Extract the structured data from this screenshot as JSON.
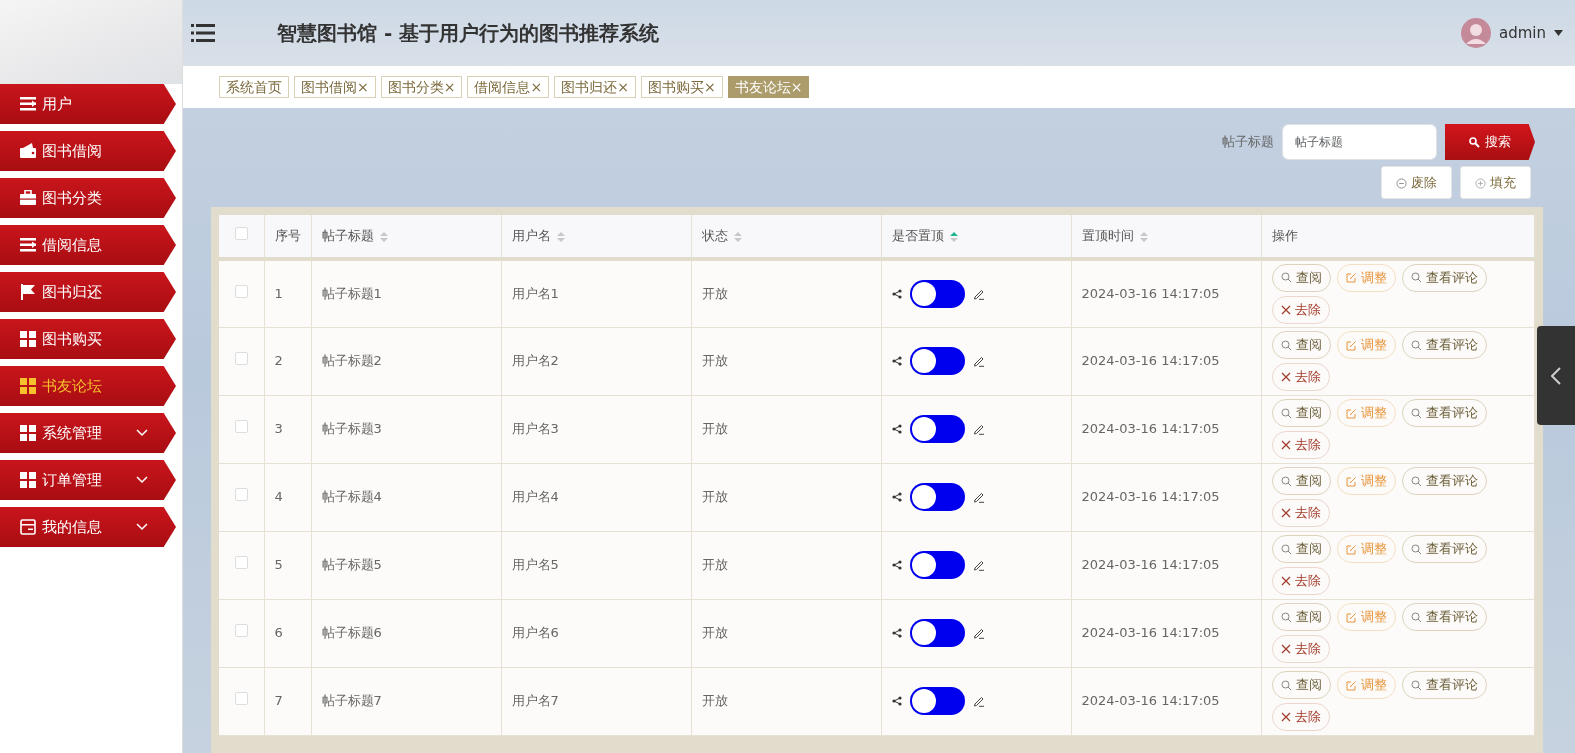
{
  "sidebar": {
    "items": [
      {
        "kind": "list",
        "label": "用户",
        "selected": false
      },
      {
        "kind": "wallet",
        "label": "图书借阅",
        "selected": false
      },
      {
        "kind": "briefcase",
        "label": "图书分类",
        "selected": false
      },
      {
        "kind": "list",
        "label": "借阅信息",
        "selected": false
      },
      {
        "kind": "flag",
        "label": "图书归还",
        "selected": false
      },
      {
        "kind": "grid",
        "label": "图书购买",
        "selected": false
      },
      {
        "kind": "grid",
        "label": "书友论坛",
        "selected": true
      },
      {
        "kind": "grid",
        "label": "系统管理",
        "selected": false,
        "expanded": false
      },
      {
        "kind": "grid",
        "label": "订单管理",
        "selected": false,
        "expanded": false
      },
      {
        "kind": "card",
        "label": "我的信息",
        "selected": false,
        "expanded": false
      }
    ]
  },
  "header": {
    "title": "智慧图书馆 - 基于用户行为的图书推荐系统",
    "user": "admin"
  },
  "tabs": [
    {
      "label": "系统首页",
      "selected": false
    },
    {
      "label": "图书借阅",
      "close": "×",
      "selected": false
    },
    {
      "label": "图书分类",
      "close": "×",
      "selected": false
    },
    {
      "label": "借阅信息",
      "close": "×",
      "selected": false
    },
    {
      "label": "图书归还",
      "close": "×",
      "selected": false
    },
    {
      "label": "图书购买",
      "close": "×",
      "selected": false
    },
    {
      "label": "书友论坛",
      "close": "×",
      "selected": true
    }
  ],
  "search": {
    "label": "帖子标题",
    "placeholder": "帖子标题",
    "button": "搜索"
  },
  "toolbar": [
    {
      "kind": "remove",
      "label": "废除"
    },
    {
      "kind": "add",
      "label": "填充"
    }
  ],
  "table": {
    "select_all": {
      "checked": false
    },
    "columns": [
      {
        "label": "序号"
      },
      {
        "label": "帖子标题",
        "sortable": true,
        "sorted": false
      },
      {
        "label": "用户名",
        "sortable": true,
        "sorted": false
      },
      {
        "label": "状态",
        "sortable": true,
        "sorted": false
      },
      {
        "label": "是否置顶",
        "sortable": true,
        "sorted": true
      },
      {
        "label": "置顶时间",
        "sortable": true,
        "sorted": false
      },
      {
        "label": "操作"
      }
    ],
    "rows": [
      {
        "checked": false,
        "cells": [
          "1",
          "帖子标题1",
          "用户名1",
          "开放"
        ],
        "pinned": false,
        "time": "2024-03-16 14:17:05",
        "actions": [
          {
            "kind": "view",
            "label": "查阅"
          },
          {
            "kind": "edit",
            "label": "调整"
          },
          {
            "kind": "view",
            "label": "查看评论"
          },
          {
            "kind": "delete",
            "label": "去除"
          }
        ]
      },
      {
        "checked": false,
        "cells": [
          "2",
          "帖子标题2",
          "用户名2",
          "开放"
        ],
        "pinned": false,
        "time": "2024-03-16 14:17:05",
        "actions": [
          {
            "kind": "view",
            "label": "查阅"
          },
          {
            "kind": "edit",
            "label": "调整"
          },
          {
            "kind": "view",
            "label": "查看评论"
          },
          {
            "kind": "delete",
            "label": "去除"
          }
        ]
      },
      {
        "checked": false,
        "cells": [
          "3",
          "帖子标题3",
          "用户名3",
          "开放"
        ],
        "pinned": false,
        "time": "2024-03-16 14:17:05",
        "actions": [
          {
            "kind": "view",
            "label": "查阅"
          },
          {
            "kind": "edit",
            "label": "调整"
          },
          {
            "kind": "view",
            "label": "查看评论"
          },
          {
            "kind": "delete",
            "label": "去除"
          }
        ]
      },
      {
        "checked": false,
        "cells": [
          "4",
          "帖子标题4",
          "用户名4",
          "开放"
        ],
        "pinned": false,
        "time": "2024-03-16 14:17:05",
        "actions": [
          {
            "kind": "view",
            "label": "查阅"
          },
          {
            "kind": "edit",
            "label": "调整"
          },
          {
            "kind": "view",
            "label": "查看评论"
          },
          {
            "kind": "delete",
            "label": "去除"
          }
        ]
      },
      {
        "checked": false,
        "cells": [
          "5",
          "帖子标题5",
          "用户名5",
          "开放"
        ],
        "pinned": false,
        "time": "2024-03-16 14:17:05",
        "actions": [
          {
            "kind": "view",
            "label": "查阅"
          },
          {
            "kind": "edit",
            "label": "调整"
          },
          {
            "kind": "view",
            "label": "查看评论"
          },
          {
            "kind": "delete",
            "label": "去除"
          }
        ]
      },
      {
        "checked": false,
        "cells": [
          "6",
          "帖子标题6",
          "用户名6",
          "开放"
        ],
        "pinned": false,
        "time": "2024-03-16 14:17:05",
        "actions": [
          {
            "kind": "view",
            "label": "查阅"
          },
          {
            "kind": "edit",
            "label": "调整"
          },
          {
            "kind": "view",
            "label": "查看评论"
          },
          {
            "kind": "delete",
            "label": "去除"
          }
        ]
      },
      {
        "checked": false,
        "cells": [
          "7",
          "帖子标题7",
          "用户名7",
          "开放"
        ],
        "pinned": false,
        "time": "2024-03-16 14:17:05",
        "actions": [
          {
            "kind": "view",
            "label": "查阅"
          },
          {
            "kind": "edit",
            "label": "调整"
          },
          {
            "kind": "view",
            "label": "查看评论"
          },
          {
            "kind": "delete",
            "label": "去除"
          }
        ]
      }
    ]
  }
}
